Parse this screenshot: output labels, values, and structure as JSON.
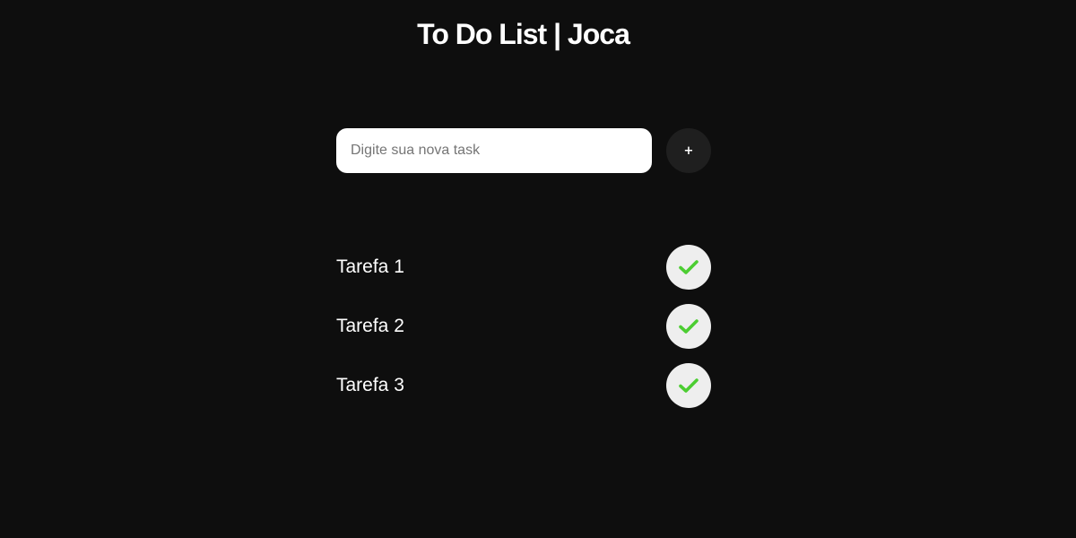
{
  "header": {
    "title": "To Do List | Joca"
  },
  "new_task": {
    "placeholder": "Digite sua nova task",
    "value": "",
    "add_label": "+"
  },
  "tasks": [
    {
      "label": "Tarefa 1",
      "icon": "check-icon"
    },
    {
      "label": "Tarefa 2",
      "icon": "check-icon"
    },
    {
      "label": "Tarefa 3",
      "icon": "check-icon"
    }
  ],
  "colors": {
    "background": "#0e0e0e",
    "check": "#4ccd32",
    "check_button_bg": "#eeeeee",
    "add_button_bg": "#1f1f1f"
  }
}
